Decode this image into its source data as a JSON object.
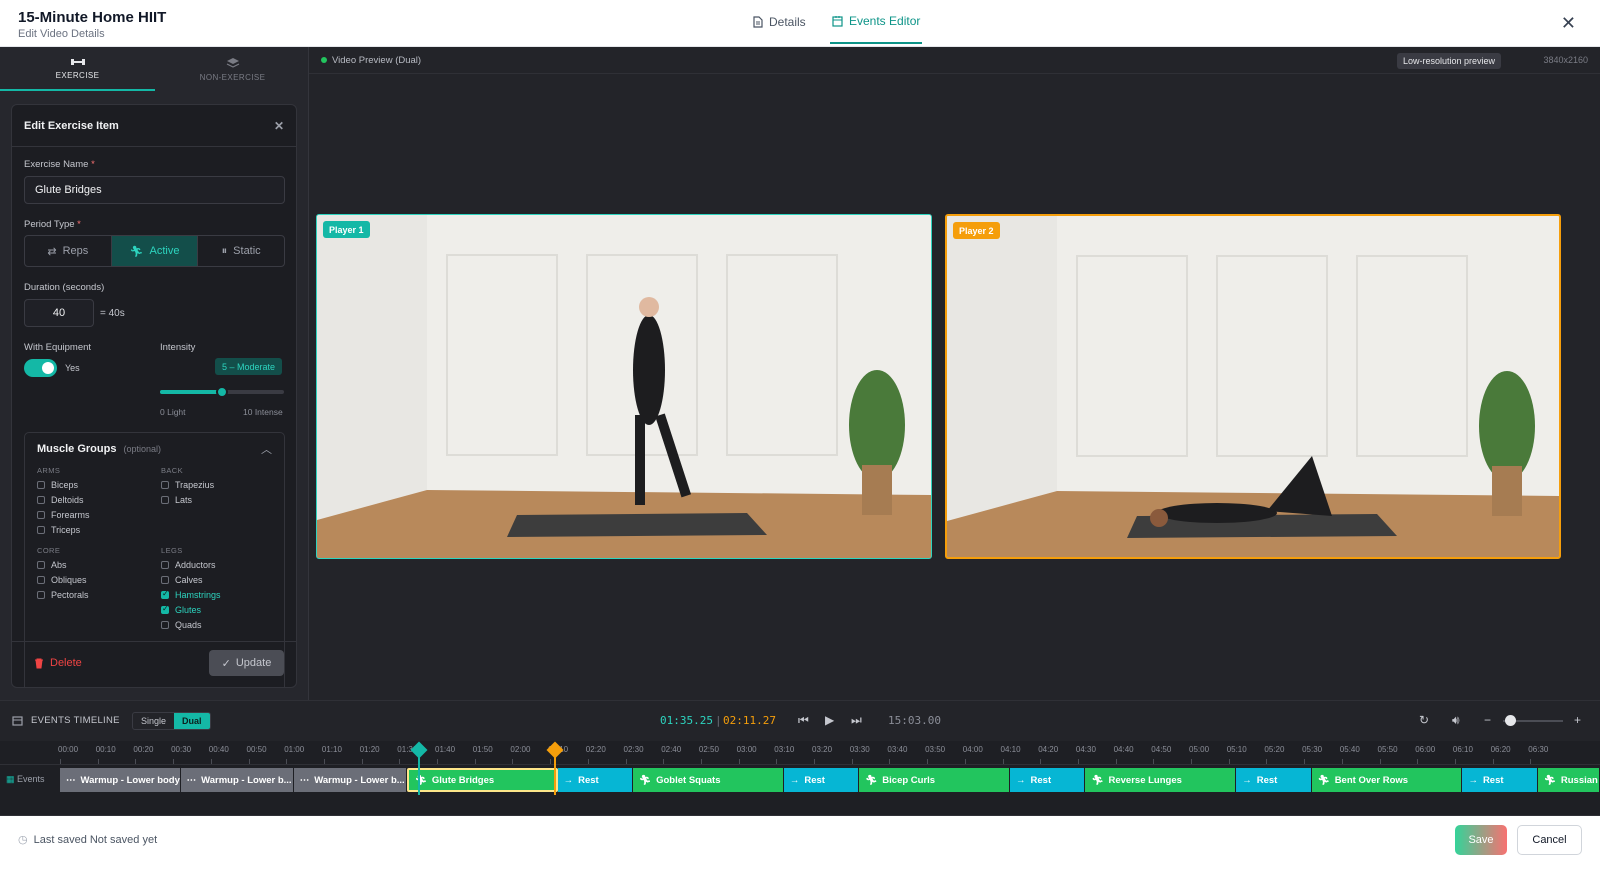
{
  "header": {
    "title": "15-Minute Home HIIT",
    "subtitle": "Edit Video Details",
    "tabs": [
      {
        "label": "Details",
        "icon": "document-icon"
      },
      {
        "label": "Events Editor",
        "icon": "calendar-icon"
      }
    ],
    "active_tab": "Events Editor"
  },
  "left_tabs": [
    {
      "label": "EXERCISE",
      "icon": "dumbbell-icon"
    },
    {
      "label": "NON-EXERCISE",
      "icon": "layers-icon"
    }
  ],
  "edit_card": {
    "title": "Edit Exercise Item",
    "exercise_name_label": "Exercise Name",
    "exercise_name_value": "Glute Bridges",
    "period_type_label": "Period Type",
    "period_types": [
      "Reps",
      "Active",
      "Static"
    ],
    "selected_period_type": "Active",
    "duration_label": "Duration (seconds)",
    "duration_value": "40",
    "duration_display": "= 40s",
    "equipment_label": "With Equipment",
    "equipment_value": "Yes",
    "equipment_enabled": true,
    "intensity_label": "Intensity",
    "intensity_badge": "5 – Moderate",
    "intensity_value": 5,
    "intensity_max": 10,
    "intensity_min_label": "0 Light",
    "intensity_max_label": "10 Intense",
    "muscle_groups": {
      "title": "Muscle Groups",
      "optional": "(optional)",
      "groups": [
        {
          "name": "ARMS",
          "items": [
            {
              "label": "Biceps",
              "checked": false
            },
            {
              "label": "Deltoids",
              "checked": false
            },
            {
              "label": "Forearms",
              "checked": false
            },
            {
              "label": "Triceps",
              "checked": false
            }
          ]
        },
        {
          "name": "BACK",
          "items": [
            {
              "label": "Trapezius",
              "checked": false
            },
            {
              "label": "Lats",
              "checked": false
            }
          ]
        },
        {
          "name": "CORE",
          "items": [
            {
              "label": "Abs",
              "checked": false
            },
            {
              "label": "Obliques",
              "checked": false
            },
            {
              "label": "Pectorals",
              "checked": false
            }
          ]
        },
        {
          "name": "LEGS",
          "items": [
            {
              "label": "Adductors",
              "checked": false
            },
            {
              "label": "Calves",
              "checked": false
            },
            {
              "label": "Hamstrings",
              "checked": true
            },
            {
              "label": "Glutes",
              "checked": true
            },
            {
              "label": "Quads",
              "checked": false
            }
          ]
        }
      ]
    },
    "delete_label": "Delete",
    "update_label": "Update"
  },
  "preview": {
    "label": "Video Preview (Dual)",
    "lowres_badge": "Low-resolution preview",
    "resolution": "3840x2160",
    "players": [
      {
        "label": "Player 1",
        "color": "#14b8a6"
      },
      {
        "label": "Player 2",
        "color": "#f59e0b"
      }
    ]
  },
  "timeline": {
    "title": "EVENTS TIMELINE",
    "modes": [
      "Single",
      "Dual"
    ],
    "active_mode": "Dual",
    "time_1": "01:35.25",
    "separator": "|",
    "time_2": "02:11.27",
    "total": "15:03.00",
    "track_label": "Events",
    "ticks": [
      "00:00",
      "00:10",
      "00:20",
      "00:30",
      "00:40",
      "00:50",
      "01:00",
      "01:10",
      "01:20",
      "01:30",
      "01:40",
      "01:50",
      "02:00",
      "02:10",
      "02:20",
      "02:30",
      "02:40",
      "02:50",
      "03:00",
      "03:10",
      "03:20",
      "03:30",
      "03:40",
      "03:50",
      "04:00",
      "04:10",
      "04:20",
      "04:30",
      "04:40",
      "04:50",
      "05:00",
      "05:10",
      "05:20",
      "05:30",
      "05:40",
      "05:50",
      "06:00",
      "06:10",
      "06:20",
      "06:30"
    ],
    "events": [
      {
        "label": "Warmup - Lower body",
        "type": "warm",
        "start": 0,
        "end": 32
      },
      {
        "label": "Warmup - Lower b...",
        "type": "warm",
        "start": 32,
        "end": 62
      },
      {
        "label": "Warmup - Lower b...",
        "type": "warm",
        "start": 62,
        "end": 92
      },
      {
        "label": "Glute Bridges",
        "type": "ex",
        "start": 92,
        "end": 132,
        "selected": true
      },
      {
        "label": "Rest",
        "type": "rest",
        "start": 132,
        "end": 152
      },
      {
        "label": "Goblet Squats",
        "type": "ex",
        "start": 152,
        "end": 192
      },
      {
        "label": "Rest",
        "type": "rest",
        "start": 192,
        "end": 212
      },
      {
        "label": "Bicep Curls",
        "type": "ex",
        "start": 212,
        "end": 252
      },
      {
        "label": "Rest",
        "type": "rest",
        "start": 252,
        "end": 272
      },
      {
        "label": "Reverse Lunges",
        "type": "ex",
        "start": 272,
        "end": 312
      },
      {
        "label": "Rest",
        "type": "rest",
        "start": 312,
        "end": 332
      },
      {
        "label": "Bent Over Rows",
        "type": "ex",
        "start": 332,
        "end": 372
      },
      {
        "label": "Rest",
        "type": "rest",
        "start": 372,
        "end": 392
      },
      {
        "label": "Russian Twists",
        "type": "ex",
        "start": 392,
        "end": 432
      }
    ],
    "playhead_1_seconds": 95.25,
    "playhead_2_seconds": 131.27
  },
  "footer": {
    "last_saved": "Last saved Not saved yet",
    "save_label": "Save",
    "cancel_label": "Cancel"
  }
}
